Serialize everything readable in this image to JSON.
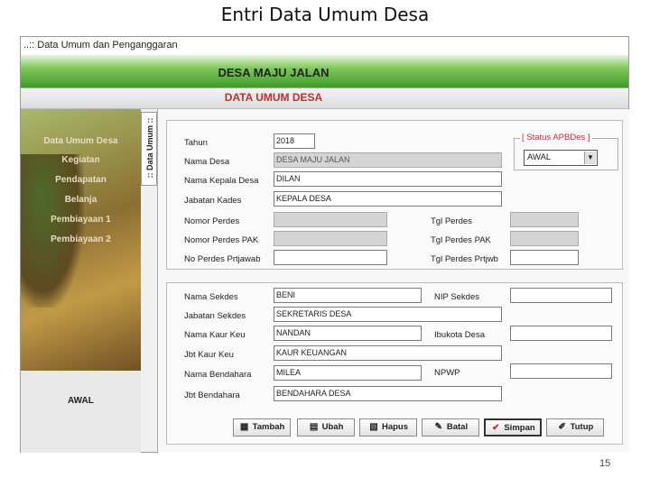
{
  "slide": {
    "title": "Entri Data Umum Desa",
    "page_number": "15"
  },
  "window": {
    "title": "..:: Data Umum dan Penganggaran"
  },
  "header": {
    "desa_name": "DESA MAJU JALAN",
    "section_title": "DATA UMUM DESA"
  },
  "sidebar": {
    "items": [
      {
        "label": "Data Umum Desa"
      },
      {
        "label": "Kegiatan"
      },
      {
        "label": "Pendapatan"
      },
      {
        "label": "Belanja"
      },
      {
        "label": "Pembiayaan 1"
      },
      {
        "label": "Pembiayaan 2"
      }
    ],
    "status": "AWAL"
  },
  "tab": {
    "label": ":: Data Umum ::"
  },
  "form": {
    "tahun": {
      "label": "Tahun",
      "value": "2018"
    },
    "nama_desa": {
      "label": "Nama Desa",
      "value": "DESA MAJU JALAN"
    },
    "nama_kepala_desa": {
      "label": "Nama Kepala Desa",
      "value": "DILAN"
    },
    "jabatan_kades": {
      "label": "Jabatan Kades",
      "value": "KEPALA DESA"
    },
    "nomor_perdes": {
      "label": "Nomor Perdes",
      "value": ""
    },
    "nomor_perdes_pak": {
      "label": "Nomor Perdes PAK",
      "value": ""
    },
    "no_perdes_prtjawab": {
      "label": "No Perdes Prtjawab",
      "value": ""
    },
    "tgl_perdes": {
      "label": "Tgl Perdes",
      "value": ""
    },
    "tgl_perdes_pak": {
      "label": "Tgl Perdes PAK",
      "value": ""
    },
    "tgl_perdes_prtjwb": {
      "label": "Tgl Perdes Prtjwb",
      "value": ""
    },
    "status_apbdes": {
      "title": "[ Status APBDes ]",
      "value": "AWAL"
    },
    "nama_sekdes": {
      "label": "Nama Sekdes",
      "value": "BENI"
    },
    "nip_sekdes": {
      "label": "NIP Sekdes",
      "value": ""
    },
    "jabatan_sekdes": {
      "label": "Jabatan Sekdes",
      "value": "SEKRETARIS DESA"
    },
    "nama_kaur_keu": {
      "label": "Nama Kaur Keu",
      "value": "NANDAN"
    },
    "ibukota_desa": {
      "label": "Ibukota Desa",
      "value": ""
    },
    "jbt_kaur_keu": {
      "label": "Jbt Kaur Keu",
      "value": "KAUR KEUANGAN"
    },
    "nama_bendahara": {
      "label": "Nama Bendahara",
      "value": "MILEA"
    },
    "npwp": {
      "label": "NPWP",
      "value": ""
    },
    "jbt_bendahara": {
      "label": "Jbt Bendahara",
      "value": "BENDAHARA DESA"
    }
  },
  "toolbar": {
    "tambah": "Tambah",
    "ubah": "Ubah",
    "hapus": "Hapus",
    "batal": "Batal",
    "simpan": "Simpan",
    "tutup": "Tutup"
  }
}
